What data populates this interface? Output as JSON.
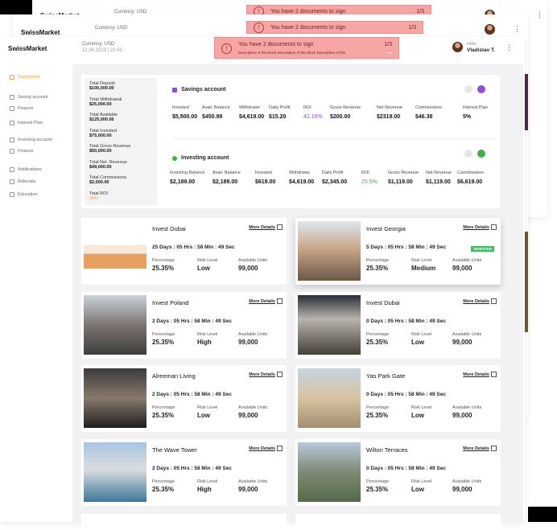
{
  "brand": "SwissMarket",
  "currency": "Currency: USD",
  "datetime": "12.04.2023 | 22:41",
  "banner": {
    "text": "You have 2 documents to sign",
    "counter": "1/3",
    "desc": "Description of this block Description of this block Description of this",
    "icon": "alert-icon"
  },
  "user": {
    "greeting": "Hello,",
    "name": "Vladislav T."
  },
  "sidebar": [
    {
      "label": "Dashboard",
      "icon": "home-icon"
    },
    {
      "label": "Saving account",
      "icon": "wallet-icon"
    },
    {
      "label": "Finance",
      "icon": "finance-icon"
    },
    {
      "label": "Interest Plan",
      "icon": "plan-icon"
    },
    {
      "label": "Investing account",
      "icon": "wallet-icon"
    },
    {
      "label": "Finance",
      "icon": "finance-icon"
    },
    {
      "label": "Notifications",
      "icon": "bell-icon"
    },
    {
      "label": "Referrals",
      "icon": "referral-icon"
    },
    {
      "label": "Education",
      "icon": "education-icon"
    }
  ],
  "totals": [
    {
      "label": "Total Deposit",
      "value": "$100,000.00"
    },
    {
      "label": "Total Withdrawal",
      "value": "$25,000.00"
    },
    {
      "label": "Total Available",
      "value": "$125,000.00"
    },
    {
      "label": "Total Invested",
      "value": "$75,000.00"
    },
    {
      "label": "Total Gross Revenue",
      "value": "$50,000.00"
    },
    {
      "label": "Total Net. Revenue",
      "value": "$49,000.00"
    },
    {
      "label": "Total Commissions",
      "value": "$2,000.00"
    },
    {
      "label": "Total ROI",
      "value": "20%"
    }
  ],
  "savings": {
    "title": "Savings account",
    "cols": [
      {
        "label": "Invested",
        "value": "$5,500.00"
      },
      {
        "label": "Avail. Balance",
        "value": "$450.99"
      },
      {
        "label": "Withdrawn",
        "value": "$4,619.00"
      },
      {
        "label": "Daily Profit",
        "value": "$15.20"
      },
      {
        "label": "ROI",
        "value": "42.16%"
      },
      {
        "label": "Gross Revenue",
        "value": "$200.00"
      },
      {
        "label": "Net Revenue",
        "value": "$2319.00"
      },
      {
        "label": "Commissions",
        "value": "$46.38"
      },
      {
        "label": "Interest Plan",
        "value": "5%"
      }
    ]
  },
  "investing": {
    "title": "Investing account",
    "cols": [
      {
        "label": "Investing Balance",
        "value": "$2,189.00"
      },
      {
        "label": "Avail. Balance",
        "value": "$2,189.00"
      },
      {
        "label": "Invested",
        "value": "$619.00"
      },
      {
        "label": "Withdrawn",
        "value": "$4,619.00"
      },
      {
        "label": "Daily Profit",
        "value": "$2,345.00"
      },
      {
        "label": "ROI",
        "value": "25.5%"
      },
      {
        "label": "Gross Revenue",
        "value": "$1,119.00"
      },
      {
        "label": "Net Revenue",
        "value": "$1,119.00"
      },
      {
        "label": "Commissions",
        "value": "$6,619.00"
      }
    ]
  },
  "cards": [
    {
      "title": "Invest Dubai",
      "timer": "25 Days : 05 Hrs : 58 Min : 49 Sec",
      "pct": "25.35%",
      "risk": "Low",
      "units": "99,000",
      "badge": ""
    },
    {
      "title": "Invest Georgia",
      "timer": "5 Days : 05 Hrs : 58 Min : 49 Sec",
      "pct": "25.35%",
      "risk": "Medium",
      "units": "99,000",
      "badge": "INVESTED"
    },
    {
      "title": "Invest Poland",
      "timer": "2 Days : 05 Hrs : 58 Min : 49 Sec",
      "pct": "25.35%",
      "risk": "High",
      "units": "99,000",
      "badge": ""
    },
    {
      "title": "Invest Dubai",
      "timer": "0 Days : 05 Hrs : 58 Min : 49 Sec",
      "pct": "25.35%",
      "risk": "Low",
      "units": "99,000",
      "badge": ""
    },
    {
      "title": "Alreeman Living",
      "timer": "2 Days : 05 Hrs : 58 Min : 49 Sec",
      "pct": "25.35%",
      "risk": "Low",
      "units": "99,000",
      "badge": ""
    },
    {
      "title": "Yas Park Gate",
      "timer": "0 Days : 05 Hrs : 58 Min : 49 Sec",
      "pct": "25.35%",
      "risk": "Low",
      "units": "99,000",
      "badge": ""
    },
    {
      "title": "The Wave Tower",
      "timer": "2 Days : 05 Hrs : 58 Min : 49 Sec",
      "pct": "25.35%",
      "risk": "High",
      "units": "99,000",
      "badge": ""
    },
    {
      "title": "Wilton Terraces",
      "timer": "0 Days : 05 Hrs : 58 Min : 49 Sec",
      "pct": "25.35%",
      "risk": "Low",
      "units": "99,000",
      "badge": ""
    }
  ],
  "labels": {
    "more": "More Details",
    "percentage": "Percentage",
    "risk": "Risk Level",
    "units": "Available Units"
  },
  "colors": {
    "accent": "#f0a040",
    "purple": "#8b4fd8",
    "green": "#3cb24a",
    "banner": "#f7a5a5"
  }
}
